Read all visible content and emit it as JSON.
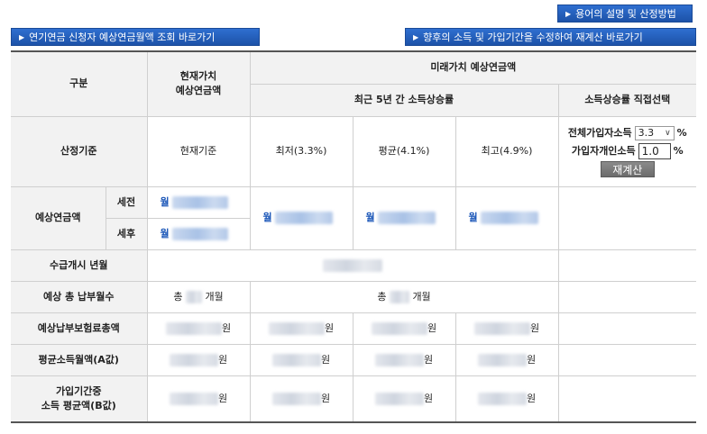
{
  "buttons": {
    "terms": "용어의 설명 및 산정방법",
    "lookup": "연기연금 신청자 예상연금월액 조회 바로가기",
    "recalc_link": "향후의 소득 및 가입기간을 수정하여 재계산 바로가기"
  },
  "table": {
    "h_category": "구분",
    "h_present_value": "현재가치\n예상연금액",
    "h_future_value": "미래가치 예상연금액",
    "h_recent5": "최근 5년 간 소득상승률",
    "h_direct_select": "소득상승률 직접선택",
    "r_basis": "산정기준",
    "basis_current": "현재기준",
    "basis_min": "최저(3.3%)",
    "basis_avg": "평균(4.1%)",
    "basis_max": "최고(4.9%)",
    "total_income_label": "전체가입자소득",
    "total_income_value": "3.3",
    "personal_income_label": "가입자개인소득",
    "personal_income_value": "1.0",
    "percent": "%",
    "recalc_button": "재계산",
    "r_expected_pension": "예상연금액",
    "pre_tax": "세전",
    "post_tax": "세후",
    "month_prefix": "월",
    "r_start_date": "수급개시 년월",
    "r_total_months": "예상 총 납부월수",
    "total_prefix": "총",
    "months_suffix": "개월",
    "r_premium_total": "예상납부보험료총액",
    "won": "원",
    "r_avg_income_a": "평균소득월액(A값)",
    "r_avg_income_b_line1": "가입기간중",
    "r_avg_income_b_line2": "소득 평균액(B값)"
  },
  "colors": {
    "accent_blue": "#1a56b8",
    "button_blue": "#1d52a8",
    "header_gray": "#f2f2f2"
  }
}
